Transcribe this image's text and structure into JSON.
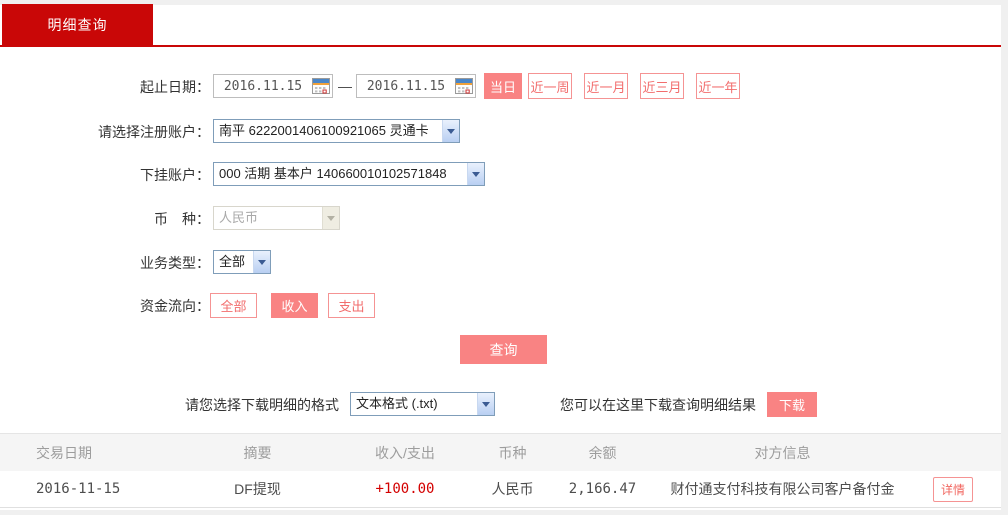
{
  "tab": {
    "label": "明细查询"
  },
  "form": {
    "date_range": {
      "label": "起止日期：",
      "start": "2016.11.15",
      "separator": "—",
      "end": "2016.11.15",
      "quick_buttons": [
        {
          "label": "当日",
          "active": true
        },
        {
          "label": "近一周",
          "active": false
        },
        {
          "label": "近一月",
          "active": false
        },
        {
          "label": "近三月",
          "active": false
        },
        {
          "label": "近一年",
          "active": false
        }
      ]
    },
    "registered_account": {
      "label": "请选择注册账户：",
      "value": "南平 6222001406100921065 灵通卡"
    },
    "sub_account": {
      "label": "下挂账户：",
      "value": "000 活期 基本户 140660010102571848"
    },
    "currency": {
      "label": "币　种：",
      "value": "人民币",
      "disabled": true
    },
    "business_type": {
      "label": "业务类型：",
      "value": "全部"
    },
    "fund_flow": {
      "label": "资金流向：",
      "options": [
        {
          "label": "全部",
          "active": false
        },
        {
          "label": "收入",
          "active": true
        },
        {
          "label": "支出",
          "active": false
        }
      ]
    },
    "query_button_label": "查询"
  },
  "download": {
    "format_label": "请您选择下载明细的格式",
    "format_value": "文本格式 (.txt)",
    "hint": "您可以在这里下载查询明细结果",
    "button_label": "下载"
  },
  "table": {
    "headers": {
      "date": "交易日期",
      "summary": "摘要",
      "in_out": "收入/支出",
      "currency": "币种",
      "balance": "余额",
      "counterparty": "对方信息"
    },
    "rows": [
      {
        "date": "2016-11-15",
        "summary": "DF提现",
        "amount": "+100.00",
        "currency": "人民币",
        "balance": "2,166.47",
        "counterparty": "财付通支付科技有限公司客户备付金",
        "action_label": "详情"
      }
    ]
  },
  "colors": {
    "brand_red": "#c90707",
    "salmon_fill": "#f98383",
    "outline_red": "#f26d6d",
    "amount_red": "#d30000",
    "select_border_blue": "#7f9db9"
  }
}
